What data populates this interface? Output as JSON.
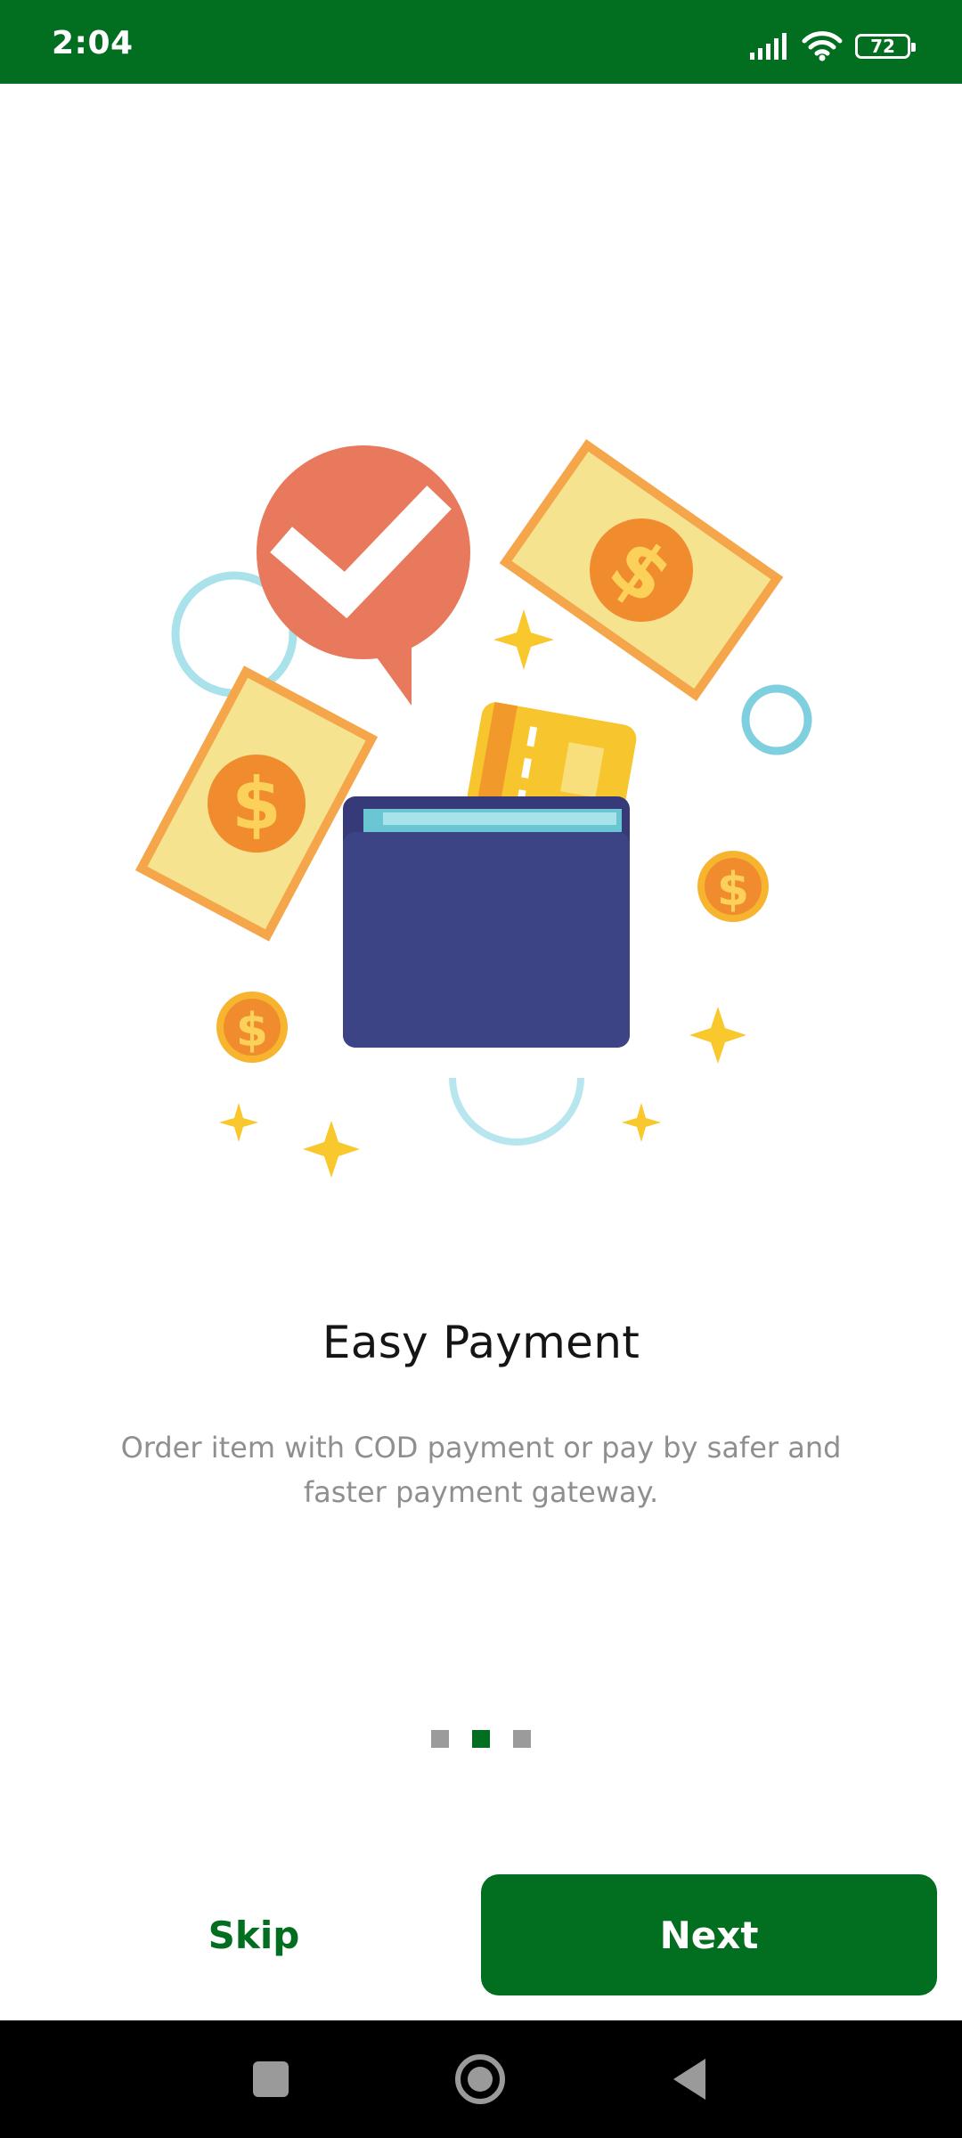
{
  "status_bar": {
    "time": "2:04",
    "battery_level": "72",
    "icons": [
      "signal-icon",
      "wifi-icon",
      "battery-icon"
    ],
    "background_color": "#026e1f"
  },
  "onboarding": {
    "illustration": "wallet-payment-illustration",
    "title": "Easy Payment",
    "description": "Order item with COD payment or pay by safer and faster payment gateway.",
    "page_indicator": {
      "total": 3,
      "current": 2
    }
  },
  "actions": {
    "skip_label": "Skip",
    "next_label": "Next"
  },
  "navigation_bar": {
    "buttons": [
      "recents-icon",
      "home-icon",
      "back-icon"
    ]
  },
  "colors": {
    "brand_green": "#026e1f",
    "title_text": "#151515",
    "body_text": "#8f8f8f",
    "inactive_dot": "#9b9b9b"
  }
}
